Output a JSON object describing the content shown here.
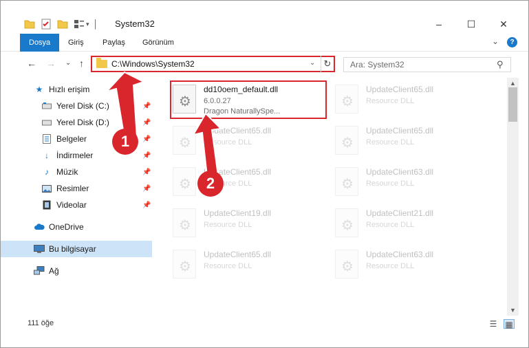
{
  "window": {
    "title": "System32",
    "minimize_glyph": "–",
    "maximize_glyph": "☐",
    "close_glyph": "✕"
  },
  "ribbon": {
    "tabs": [
      {
        "label": "Dosya",
        "active": true
      },
      {
        "label": "Giriş",
        "active": false
      },
      {
        "label": "Paylaş",
        "active": false
      },
      {
        "label": "Görünüm",
        "active": false
      }
    ],
    "expand_glyph": "⌄",
    "help_glyph": "?"
  },
  "address": {
    "path": "C:\\Windows\\System32",
    "dropdown_glyph": "⌄",
    "refresh_glyph": "↻"
  },
  "search": {
    "placeholder": "Ara: System32",
    "icon": "search-icon"
  },
  "nav_buttons": {
    "back": "←",
    "forward": "→",
    "recent": "⌄",
    "up": "↑"
  },
  "sidebar": {
    "items": [
      {
        "label": "Hızlı erişim",
        "icon": "star-icon",
        "pinned": false
      },
      {
        "label": "Yerel Disk (C:)",
        "icon": "drive-icon",
        "pinned": true
      },
      {
        "label": "Yerel Disk (D:)",
        "icon": "drive-icon",
        "pinned": true
      },
      {
        "label": "Belgeler",
        "icon": "documents-icon",
        "pinned": true
      },
      {
        "label": "İndirmeler",
        "icon": "download-icon",
        "pinned": true
      },
      {
        "label": "Müzik",
        "icon": "music-icon",
        "pinned": true
      },
      {
        "label": "Resimler",
        "icon": "pictures-icon",
        "pinned": true
      },
      {
        "label": "Videolar",
        "icon": "video-icon",
        "pinned": true
      },
      {
        "label": "OneDrive",
        "icon": "cloud-icon",
        "pinned": false
      },
      {
        "label": "Bu bilgisayar",
        "icon": "computer-icon",
        "pinned": false
      },
      {
        "label": "Ağ",
        "icon": "network-icon",
        "pinned": false
      }
    ],
    "selected": "Bu bilgisayar"
  },
  "files": [
    {
      "name": "dd10oem_default.dll",
      "version": "6.0.0.27",
      "description": "Dragon NaturallySpe...",
      "highlighted": true
    },
    {
      "name": "UpdateClient65.dll",
      "version": "",
      "description": "Resource DLL",
      "highlighted": false
    },
    {
      "name": "UpdateClient65.dll",
      "version": "",
      "description": "Resource DLL",
      "highlighted": false
    },
    {
      "name": "UpdateClient65.dll",
      "version": "",
      "description": "Resource DLL",
      "highlighted": false
    },
    {
      "name": "UpdateClient65.dll",
      "version": "",
      "description": "Resource DLL",
      "highlighted": false
    },
    {
      "name": "UpdateClient63.dll",
      "version": "",
      "description": "Resource DLL",
      "highlighted": false
    },
    {
      "name": "UpdateClient19.dll",
      "version": "",
      "description": "Resource DLL",
      "highlighted": false
    },
    {
      "name": "UpdateClient21.dll",
      "version": "",
      "description": "Resource DLL",
      "highlighted": false
    },
    {
      "name": "UpdateClient65.dll",
      "version": "",
      "description": "Resource DLL",
      "highlighted": false
    },
    {
      "name": "UpdateClient63.dll",
      "version": "",
      "description": "Resource DLL",
      "highlighted": false
    }
  ],
  "status": {
    "item_count": "111 öğe"
  },
  "annotations": {
    "step1": "1",
    "step2": "2",
    "color": "#d9262c"
  },
  "colors": {
    "accent": "#1979ca",
    "selection": "#cde3f7",
    "highlight_border": "#d9262c",
    "folder": "#f3c74a"
  }
}
